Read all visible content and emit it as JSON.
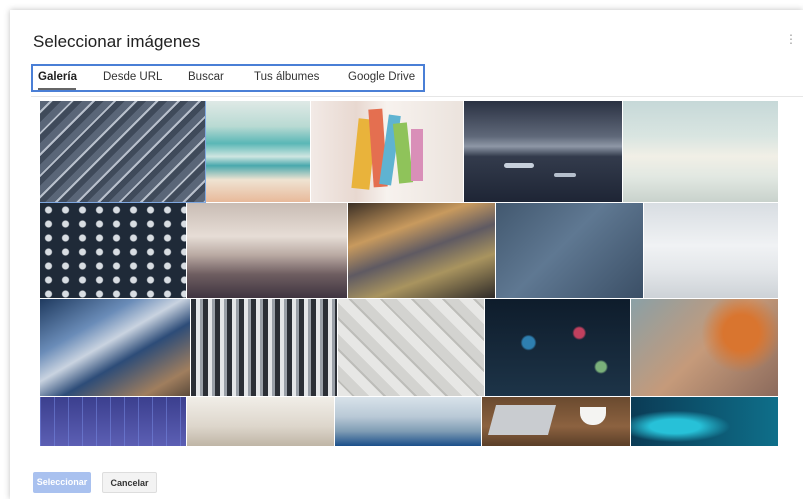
{
  "dialog": {
    "title": "Seleccionar imágenes",
    "tabs": [
      {
        "label": "Galería",
        "active": true
      },
      {
        "label": "Desde URL",
        "active": false
      },
      {
        "label": "Buscar",
        "active": false
      },
      {
        "label": "Tus álbumes",
        "active": false
      },
      {
        "label": "Google Drive",
        "active": false
      }
    ],
    "footer": {
      "select_label": "Seleccionar",
      "cancel_label": "Cancelar"
    }
  },
  "colors": {
    "tab_highlight": "#4a7fd6",
    "select_button": "#a9c1ef"
  }
}
